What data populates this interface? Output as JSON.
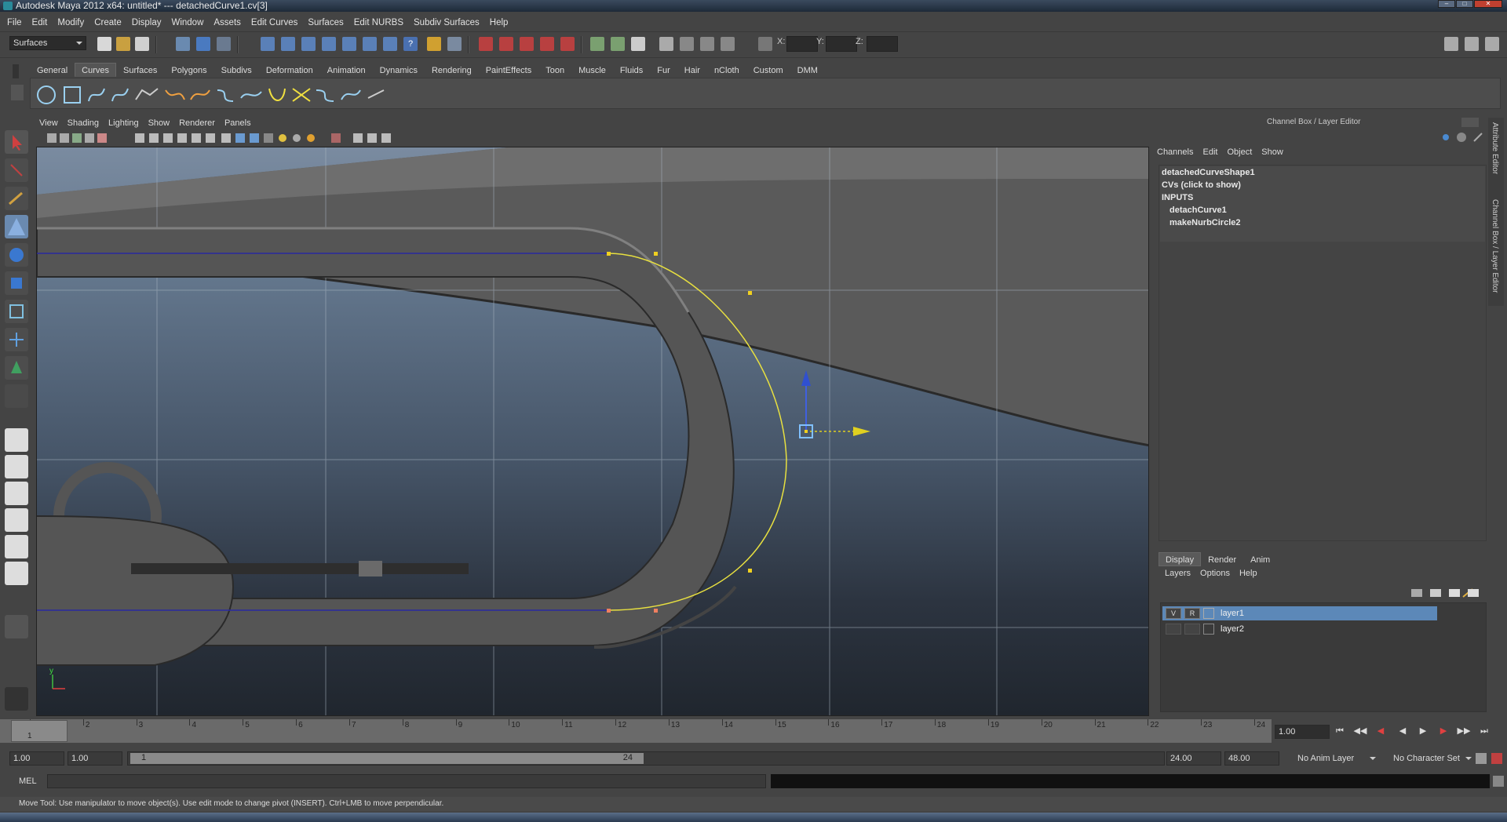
{
  "window": {
    "title": "Autodesk Maya 2012 x64: untitled*   ---   detachedCurve1.cv[3]"
  },
  "menubar": {
    "items": [
      "File",
      "Edit",
      "Modify",
      "Create",
      "Display",
      "Window",
      "Assets",
      "Edit Curves",
      "Surfaces",
      "Edit NURBS",
      "Subdiv Surfaces",
      "Help"
    ]
  },
  "statusline": {
    "menuset": "Surfaces",
    "x_label": "X:",
    "y_label": "Y:",
    "z_label": "Z:"
  },
  "shelf": {
    "tabs": [
      "General",
      "Curves",
      "Surfaces",
      "Polygons",
      "Subdivs",
      "Deformation",
      "Animation",
      "Dynamics",
      "Rendering",
      "PaintEffects",
      "Toon",
      "Muscle",
      "Fluids",
      "Fur",
      "Hair",
      "nCloth",
      "Custom",
      "DMM"
    ],
    "active": "Curves"
  },
  "panel": {
    "menu": [
      "View",
      "Shading",
      "Lighting",
      "Show",
      "Renderer",
      "Panels"
    ],
    "axis_y": "y",
    "axis_x": "x"
  },
  "channelbox": {
    "header": "Channel Box / Layer Editor",
    "menu": [
      "Channels",
      "Edit",
      "Object",
      "Show"
    ],
    "shape": "detachedCurveShape1",
    "cvs": "CVs (click to show)",
    "inputs": "INPUTS",
    "input1": "detachCurve1",
    "input2": "makeNurbCircle2"
  },
  "layereditor": {
    "tabs": [
      "Display",
      "Render",
      "Anim"
    ],
    "menu": [
      "Layers",
      "Options",
      "Help"
    ],
    "layers": [
      {
        "v": "V",
        "r": "R",
        "name": "layer1",
        "selected": true
      },
      {
        "v": "",
        "r": "",
        "name": "layer2",
        "selected": false
      }
    ]
  },
  "sidetabs": {
    "attr": "Attribute Editor",
    "cb": "Channel Box / Layer Editor"
  },
  "timeline": {
    "ticks": [
      "1",
      "2",
      "3",
      "4",
      "5",
      "6",
      "7",
      "8",
      "9",
      "10",
      "11",
      "12",
      "13",
      "14",
      "15",
      "16",
      "17",
      "18",
      "19",
      "20",
      "21",
      "22",
      "23",
      "24"
    ],
    "current": "1",
    "current_field": "1.00"
  },
  "range": {
    "start": "1.00",
    "start2": "1.00",
    "slider_start": "1",
    "slider_end": "24",
    "end1": "24.00",
    "end2": "48.00",
    "anim_layer": "No Anim Layer",
    "char_set": "No Character Set"
  },
  "cmd": {
    "label": "MEL"
  },
  "help": {
    "text": "Move Tool: Use manipulator to move object(s). Use edit mode to change pivot (INSERT).  Ctrl+LMB to move perpendicular."
  },
  "colors": {
    "selection": "#5c88b8",
    "curve": "#e8e040",
    "cv": "#f0d020"
  }
}
